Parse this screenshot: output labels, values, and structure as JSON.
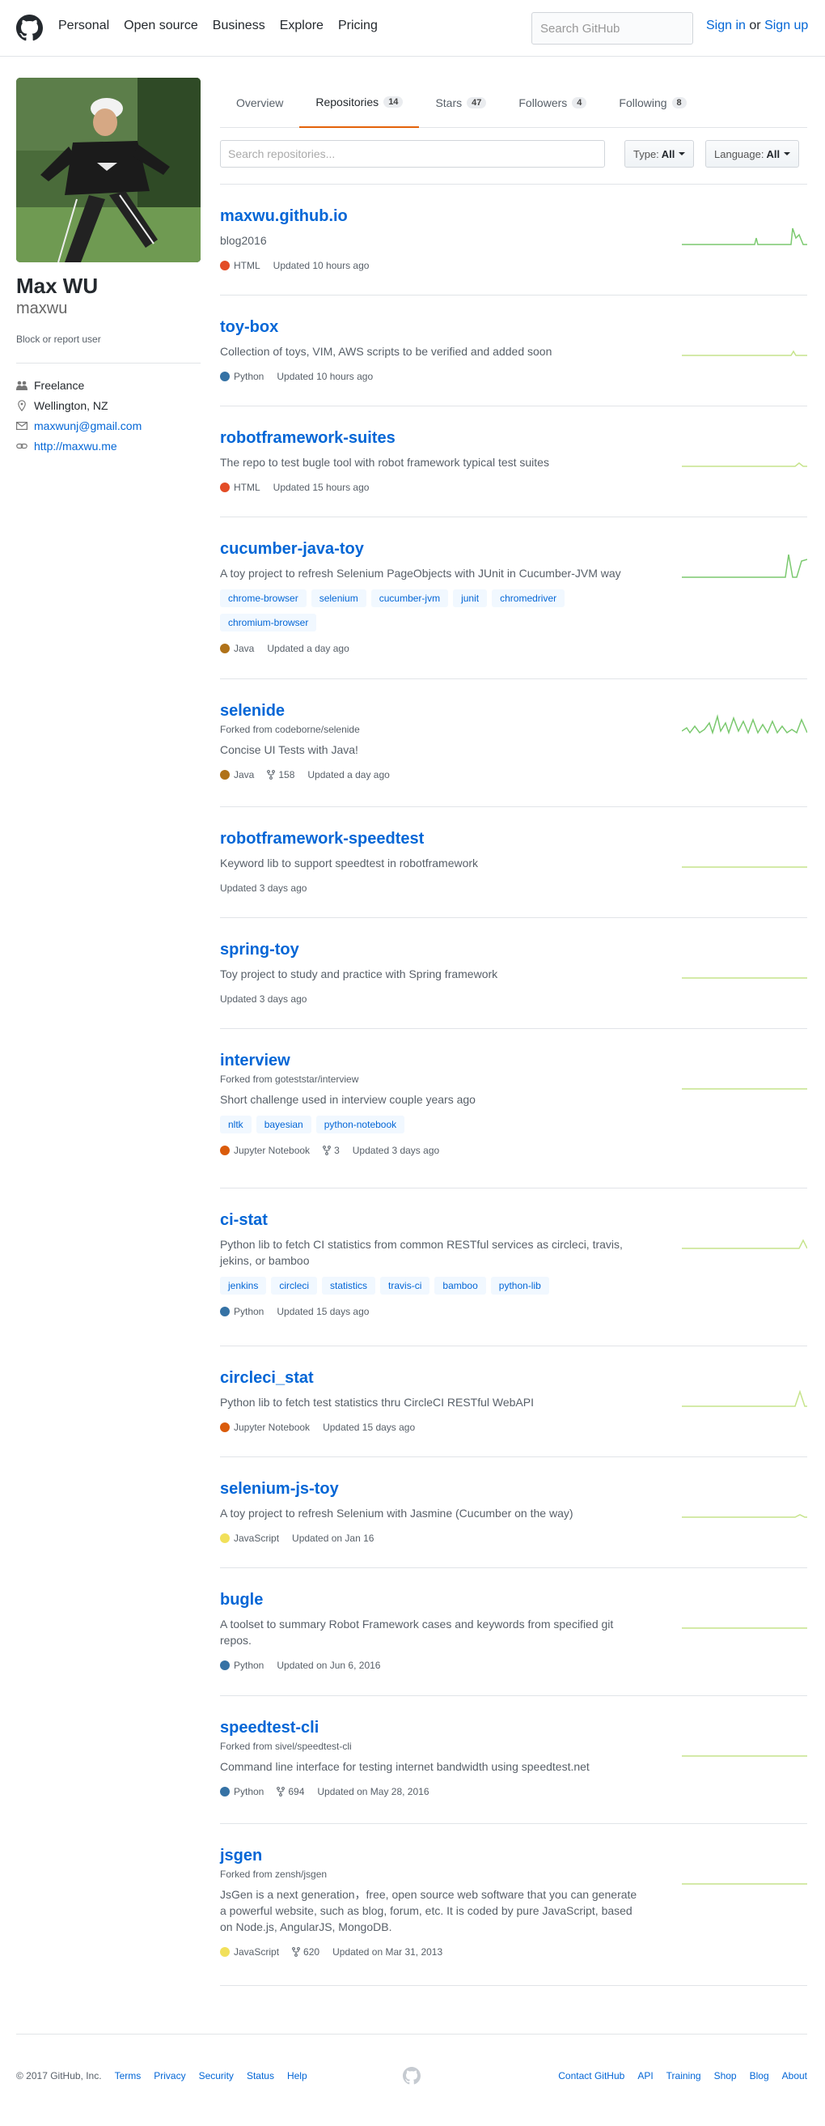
{
  "header": {
    "nav": [
      "Personal",
      "Open source",
      "Business",
      "Explore",
      "Pricing"
    ],
    "search_placeholder": "Search GitHub",
    "sign_in": "Sign in",
    "or": "or",
    "sign_up": "Sign up"
  },
  "profile": {
    "fullname": "Max WU",
    "username": "maxwu",
    "block_report": "Block or report user",
    "company": "Freelance",
    "location": "Wellington, NZ",
    "email": "maxwunj@gmail.com",
    "website": "http://maxwu.me"
  },
  "tabs": [
    {
      "label": "Overview"
    },
    {
      "label": "Repositories",
      "count": "14"
    },
    {
      "label": "Stars",
      "count": "47"
    },
    {
      "label": "Followers",
      "count": "4"
    },
    {
      "label": "Following",
      "count": "8"
    }
  ],
  "filters": {
    "search_placeholder": "Search repositories...",
    "type_label": "Type:",
    "type_value": "All",
    "language_label": "Language:",
    "language_value": "All"
  },
  "colors": {
    "HTML": "#e34c26",
    "Python": "#3572A5",
    "Java": "#b07219",
    "Jupyter Notebook": "#DA5B0B",
    "JavaScript": "#f1e05a",
    "spark": "#c6e48b",
    "spark_active": "#7bc96f"
  },
  "repos": [
    {
      "name": "maxwu.github.io",
      "fork": "",
      "desc": "blog2016",
      "topics": [],
      "language": "HTML",
      "forks": "",
      "updated": "Updated 10 hours ago",
      "spark": "high1"
    },
    {
      "name": "toy-box",
      "fork": "",
      "desc": "Collection of toys, VIM, AWS scripts to be verified and added soon",
      "topics": [],
      "language": "Python",
      "forks": "",
      "updated": "Updated 10 hours ago",
      "spark": "low1"
    },
    {
      "name": "robotframework-suites",
      "fork": "",
      "desc": "The repo to test bugle tool with robot framework typical test suites",
      "topics": [],
      "language": "HTML",
      "forks": "",
      "updated": "Updated 15 hours ago",
      "spark": "low2"
    },
    {
      "name": "cucumber-java-toy",
      "fork": "",
      "desc": "A toy project to refresh Selenium PageObjects with JUnit in Cucumber-JVM way",
      "topics": [
        "chrome-browser",
        "selenium",
        "cucumber-jvm",
        "junit",
        "chromedriver",
        "chromium-browser"
      ],
      "language": "Java",
      "forks": "",
      "updated": "Updated a day ago",
      "spark": "high2"
    },
    {
      "name": "selenide",
      "fork": "Forked from codeborne/selenide",
      "desc": "Concise UI Tests with Java!",
      "topics": [],
      "language": "Java",
      "forks": "158",
      "updated": "Updated a day ago",
      "spark": "busy"
    },
    {
      "name": "robotframework-speedtest",
      "fork": "",
      "desc": "Keyword lib to support speedtest in robotframework",
      "topics": [],
      "language": "",
      "forks": "",
      "updated": "Updated 3 days ago",
      "spark": "flat"
    },
    {
      "name": "spring-toy",
      "fork": "",
      "desc": "Toy project to study and practice with Spring framework",
      "topics": [],
      "language": "",
      "forks": "",
      "updated": "Updated 3 days ago",
      "spark": "flat"
    },
    {
      "name": "interview",
      "fork": "Forked from goteststar/interview",
      "desc": "Short challenge used in interview couple years ago",
      "topics": [
        "nltk",
        "bayesian",
        "python-notebook"
      ],
      "language": "Jupyter Notebook",
      "forks": "3",
      "updated": "Updated 3 days ago",
      "spark": "flat"
    },
    {
      "name": "ci-stat",
      "fork": "",
      "desc": "Python lib to fetch CI statistics from common RESTful services as circleci, travis, jekins, or bamboo",
      "topics": [
        "jenkins",
        "circleci",
        "statistics",
        "travis-ci",
        "bamboo",
        "python-lib"
      ],
      "language": "Python",
      "forks": "",
      "updated": "Updated 15 days ago",
      "spark": "low3"
    },
    {
      "name": "circleci_stat",
      "fork": "",
      "desc": "Python lib to fetch test statistics thru CircleCI RESTful WebAPI",
      "topics": [],
      "language": "Jupyter Notebook",
      "forks": "",
      "updated": "Updated 15 days ago",
      "spark": "low4"
    },
    {
      "name": "selenium-js-toy",
      "fork": "",
      "desc": "A toy project to refresh Selenium with Jasmine (Cucumber on the way)",
      "topics": [],
      "language": "JavaScript",
      "forks": "",
      "updated": "Updated on Jan 16",
      "spark": "low5"
    },
    {
      "name": "bugle",
      "fork": "",
      "desc": "A toolset to summary Robot Framework cases and keywords from specified git repos.",
      "topics": [],
      "language": "Python",
      "forks": "",
      "updated": "Updated on Jun 6, 2016",
      "spark": "flat"
    },
    {
      "name": "speedtest-cli",
      "fork": "Forked from sivel/speedtest-cli",
      "desc": "Command line interface for testing internet bandwidth using speedtest.net",
      "topics": [],
      "language": "Python",
      "forks": "694",
      "updated": "Updated on May 28, 2016",
      "spark": "flat"
    },
    {
      "name": "jsgen",
      "fork": "Forked from zensh/jsgen",
      "desc": "JsGen is a next generation，free, open source web software that you can generate a powerful website, such as blog, forum, etc. It is coded by pure JavaScript, based on Node.js, AngularJS, MongoDB.",
      "topics": [],
      "language": "JavaScript",
      "forks": "620",
      "updated": "Updated on Mar 31, 2013",
      "spark": "flat"
    }
  ],
  "footer": {
    "copyright": "© 2017 GitHub, Inc.",
    "left_links": [
      "Terms",
      "Privacy",
      "Security",
      "Status",
      "Help"
    ],
    "right_links": [
      "Contact GitHub",
      "API",
      "Training",
      "Shop",
      "Blog",
      "About"
    ]
  }
}
